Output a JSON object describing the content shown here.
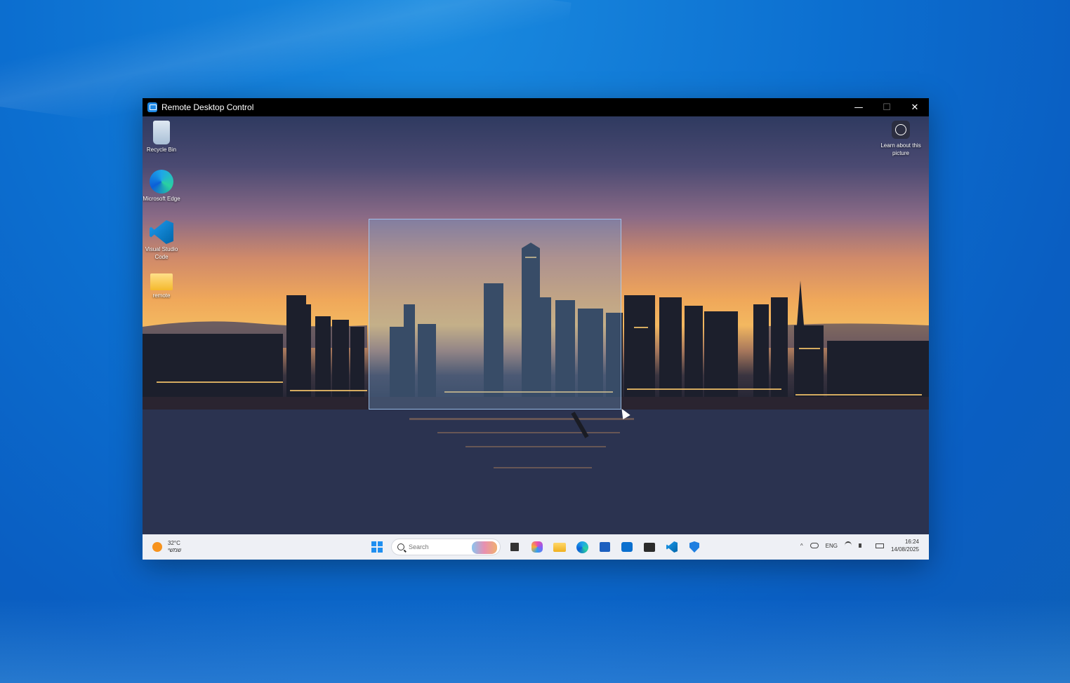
{
  "window": {
    "title": "Remote Desktop Control",
    "controls": {
      "minimize": "—",
      "maximize": "☐",
      "close": "✕"
    }
  },
  "remote_desktop": {
    "icons": [
      {
        "label": "Recycle Bin",
        "icon": "recycle-bin-icon"
      },
      {
        "label": "Microsoft Edge",
        "icon": "edge-icon"
      },
      {
        "label": "Visual Studio Code",
        "icon": "vscode-icon"
      },
      {
        "label": "remote",
        "icon": "folder-icon"
      }
    ],
    "learn_label": "Learn about this picture"
  },
  "taskbar": {
    "weather": {
      "temp": "32°C",
      "desc": "שמשי"
    },
    "search_placeholder": "Search",
    "tray": {
      "language": "ENG",
      "time": "16:24",
      "date": "14/08/2025"
    }
  },
  "colors": {
    "accent": "#1f8ff0",
    "desktop_bg": "#0c6fd0"
  }
}
